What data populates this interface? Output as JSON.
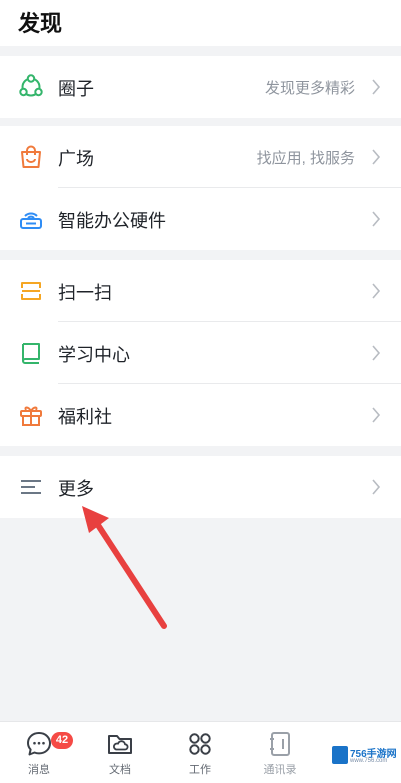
{
  "header": {
    "title": "发现"
  },
  "groups": {
    "g1": {
      "circle": {
        "label": "圈子",
        "sub": "发现更多精彩",
        "icon": "circle-network-icon"
      }
    },
    "g2": {
      "square": {
        "label": "广场",
        "sub": "找应用, 找服务",
        "icon": "shopping-bag-icon"
      },
      "hardware": {
        "label": "智能办公硬件",
        "icon": "router-device-icon"
      }
    },
    "g3": {
      "scan": {
        "label": "扫一扫",
        "icon": "scan-icon"
      },
      "learning": {
        "label": "学习中心",
        "icon": "book-icon"
      },
      "welfare": {
        "label": "福利社",
        "icon": "gift-icon"
      }
    },
    "g4": {
      "more": {
        "label": "更多",
        "icon": "menu-lines-icon"
      }
    }
  },
  "tabbar": {
    "messages": {
      "label": "消息",
      "badge": "42"
    },
    "docs": {
      "label": "文档"
    },
    "work": {
      "label": "工作"
    },
    "contacts": {
      "label": "通讯录"
    }
  },
  "watermark": {
    "brand": "756手游网",
    "url": "www.756.com"
  },
  "colors": {
    "green": "#34b56b",
    "orange": "#f07a3c",
    "blue": "#2f8df5",
    "yellow": "#f5a623",
    "gray_icon": "#6b7785",
    "red_arrow": "#e8403f",
    "badge": "#f54a45"
  }
}
